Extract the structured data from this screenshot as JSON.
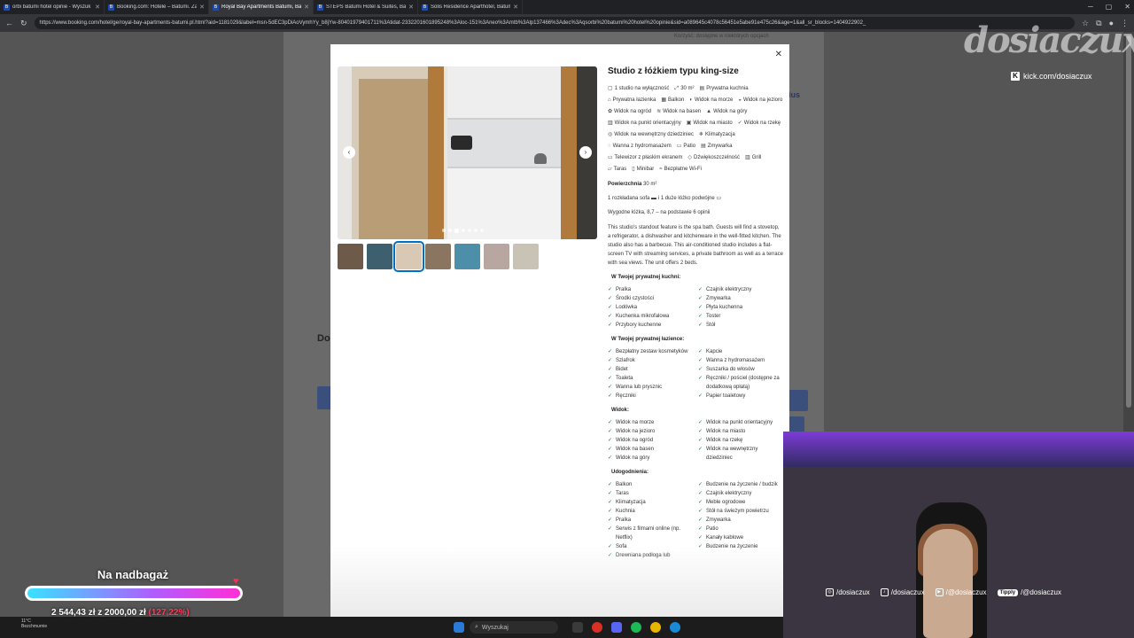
{
  "browser": {
    "tabs": [
      {
        "title": "orbi batumi hotel opinie - Wyszuk",
        "active": false
      },
      {
        "title": "Booking.com: Hotele – Batumi. Za",
        "active": false
      },
      {
        "title": "Royal Bay Apartments Batumi, Ba",
        "active": true
      },
      {
        "title": "STEPS Batumi Hotel & Suites, Bat",
        "active": false
      },
      {
        "title": "Solis Residence Aparthotel, Batum",
        "active": false
      }
    ],
    "url": "https://www.booking.com/hotel/ge/royal-bay-apartments-batumi.pl.html?aid=1181029&label=msn-5dEC3pDiAoVymhYy_b8jYw-80401979401711%3Atidat-2332201601895248%3Aloc-151%3Aneo%3Amtb%3Alp137466%3Adec%3Aqsorbi%20batumi%20hotel%20opinie&sid=a089645c4078c56451e5abe91e475c26&age=1&all_sr_blocks=1404922902_"
  },
  "background_page": {
    "top_note": "Korzyść: dostępne w niektórych opcjach",
    "section_title": "Do",
    "side_link": "ius"
  },
  "modal": {
    "close_icon": "close-icon",
    "title": "Studio z łóżkiem typu king-size",
    "facilities": [
      {
        "icon": "▢",
        "label": "1 studio na wyłączność"
      },
      {
        "icon": "⤢",
        "label": "30 m²"
      },
      {
        "icon": "▤",
        "label": "Prywatna kuchnia"
      },
      {
        "icon": "⌂",
        "label": "Prywatna łazienka"
      },
      {
        "icon": "▦",
        "label": "Balkon"
      },
      {
        "icon": "◐",
        "label": "Widok na morze"
      },
      {
        "icon": "◒",
        "label": "Widok na jezioro"
      },
      {
        "icon": "✿",
        "label": "Widok na ogród"
      },
      {
        "icon": "≋",
        "label": "Widok na basen"
      },
      {
        "icon": "▲",
        "label": "Widok na góry"
      },
      {
        "icon": "▥",
        "label": "Widok na punkt orientacyjny"
      },
      {
        "icon": "▣",
        "label": "Widok na miasto"
      },
      {
        "icon": "✓",
        "label": "Widok na rzekę"
      },
      {
        "icon": "◎",
        "label": "Widok na wewnętrzny dziedziniec"
      },
      {
        "icon": "❄",
        "label": "Klimatyzacja"
      },
      {
        "icon": "◌",
        "label": "Wanna z hydromasażem"
      },
      {
        "icon": "▭",
        "label": "Patio"
      },
      {
        "icon": "▤",
        "label": "Zmywarka"
      },
      {
        "icon": "▭",
        "label": "Telewizor z płaskim ekranem"
      },
      {
        "icon": "◇",
        "label": "Dźwiękoszczelność"
      },
      {
        "icon": "▥",
        "label": "Grill"
      },
      {
        "icon": "▱",
        "label": "Taras"
      },
      {
        "icon": "▯",
        "label": "Minibar"
      },
      {
        "icon": "≈",
        "label": "Bezpłatne Wi-Fi"
      }
    ],
    "area_label": "Powierzchnia",
    "area_value": "30 m²",
    "beds_text": "1 rozkładana sofa",
    "beds_text2": "i 1 duże łóżko podwójne",
    "rating_text": "Wygodne łóżka, 8,7 – na podstawie 6 opinii",
    "description": "This studio's standout feature is the spa bath. Guests will find a stovetop, a refrigerator, a dishwasher and kitchenware in the well-fitted kitchen. The studio also has a barbecue. This air-conditioned studio includes a flat-screen TV with streaming services, a private bathroom as well as a terrace with sea views. The unit offers 2 beds.",
    "sections": [
      {
        "heading": "W Twojej prywatnej kuchni:",
        "left": [
          "Pralka",
          "Środki czystości",
          "Lodówka",
          "Kuchenka mikrofalowa",
          "Przybory kuchenne"
        ],
        "right": [
          "Czajnik elektryczny",
          "Zmywarka",
          "Płyta kuchenna",
          "Toster",
          "Stół"
        ]
      },
      {
        "heading": "W Twojej prywatnej łazience:",
        "left": [
          "Bezpłatny zestaw kosmetyków",
          "Szlafrok",
          "Bidet",
          "Toaleta",
          "Wanna lub prysznic",
          "Ręczniki"
        ],
        "right": [
          "Kapcie",
          "Wanna z hydromasażem",
          "Suszarka do włosów",
          "Ręczniki / pościel (dostępne za dodatkową opłatą)",
          "Papier toaletowy"
        ]
      },
      {
        "heading": "Widok:",
        "left": [
          "Widok na morze",
          "Widok na jezioro",
          "Widok na ogród",
          "Widok na basen",
          "Widok na góry"
        ],
        "right": [
          "Widok na punkt orientacyjny",
          "Widok na miasto",
          "Widok na rzekę",
          "Widok na wewnętrzny dziedziniec"
        ]
      },
      {
        "heading": "Udogodnienia:",
        "left": [
          "Balkon",
          "Taras",
          "Klimatyzacja",
          "Kuchnia",
          "Pralka",
          "Serwis z filmami online (np. Netflix)",
          "Sofa",
          "Drewniana podłoga lub"
        ],
        "right": [
          "Budzenie na życzenie / budzik",
          "Czajnik elektryczny",
          "Meble ogrodowe",
          "Stół na świeżym powietrzu",
          "Zmywarka",
          "Patio",
          "Kanały kablowe",
          "Budzenie na życzenie"
        ]
      }
    ],
    "gallery": {
      "photo_count": 7,
      "active_index": 2,
      "thumb_colors": [
        "#6e5a48",
        "#3e5f6e",
        "#d9c9b4",
        "#8a7561",
        "#4d8fa8",
        "#b7a7a0",
        "#c9c3b6"
      ]
    }
  },
  "taskbar": {
    "weather_temp": "11°C",
    "weather_desc": "Bezchmurnie",
    "search_placeholder": "Wyszukaj"
  },
  "stream": {
    "logo": "dosiaczux",
    "kick_url": "kick.com/dosiaczux",
    "socials": [
      {
        "icon": "instagram-icon",
        "glyph": "◎",
        "handle": "/dosiaczux"
      },
      {
        "icon": "tiktok-icon",
        "glyph": "♪",
        "handle": "/dosiaczux"
      },
      {
        "icon": "youtube-icon",
        "glyph": "▶",
        "handle": "/@dosiaczux"
      }
    ],
    "tipply_label": "Tipply",
    "tipply_handle": "/@dosiaczux",
    "goal": {
      "title": "Na nadbagaż",
      "amount": "2 544,43 zł z 2000,00 zł",
      "percent": "(127,22%)",
      "progress": 1.0
    }
  },
  "colors": {
    "accent": "#0071c2",
    "check": "#008234",
    "goal_pink": "#ff2fd6",
    "goal_cyan": "#38e1ff"
  }
}
